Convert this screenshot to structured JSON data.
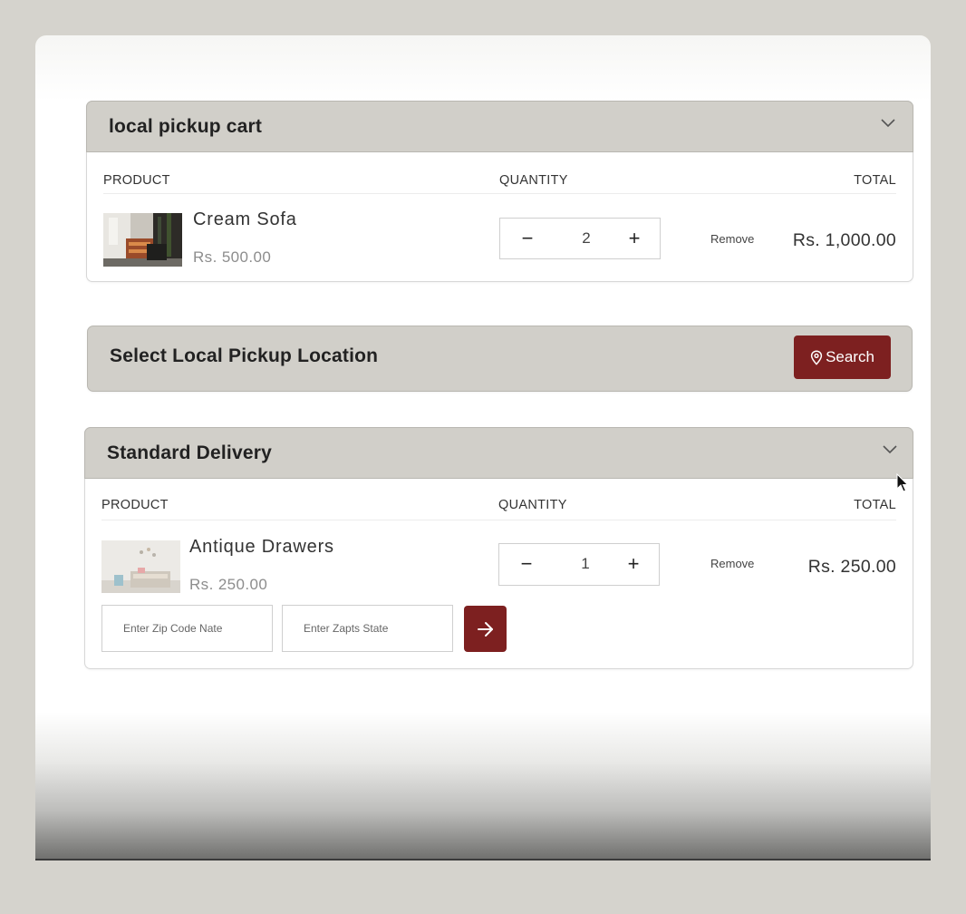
{
  "local_cart": {
    "title": "local pickup cart",
    "columns": {
      "product": "PRODUCT",
      "quantity": "QUANTITY",
      "total": "TOTAL"
    },
    "item": {
      "name": "Cream Sofa",
      "price": "Rs. 500.00",
      "quantity": "2",
      "minus": "−",
      "plus": "+",
      "remove_label": "Remove",
      "total": "Rs. 1,000.00"
    }
  },
  "pickup_location": {
    "title": "Select Local Pickup Location",
    "search_label": "Search"
  },
  "standard_delivery": {
    "title": "Standard Delivery",
    "columns": {
      "product": "PRODUCT",
      "quantity": "QUANTITY",
      "total": "TOTAL"
    },
    "item": {
      "name": "Antique Drawers",
      "price": "Rs. 250.00",
      "quantity": "1",
      "minus": "−",
      "plus": "+",
      "remove_label": "Remove",
      "total": "Rs. 250.00"
    },
    "zip_placeholder": "Enter Zip Code Nate",
    "state_placeholder": "Enter Zapts State"
  },
  "colors": {
    "accent": "#7d2020",
    "header_bg": "#d1cfc9",
    "outer_bg": "#d5d3cd"
  },
  "icons": [
    "chevron-down-icon",
    "location-pin-icon",
    "arrow-right-icon",
    "mouse-cursor-icon"
  ]
}
